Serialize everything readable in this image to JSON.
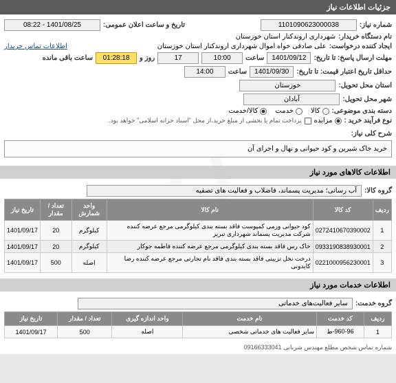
{
  "header": {
    "title": "جزئیات اطلاعات نیاز"
  },
  "info": {
    "need_number_label": "شماره نیاز:",
    "need_number": "1101090623000038",
    "announce_label": "تاریخ و ساعت اعلان عمومی:",
    "announce_value": "1401/08/25 - 08:22",
    "buyer_org_label": "نام دستگاه خریدار:",
    "buyer_org": "شهرداری اروندکنار استان خوزستان",
    "requester_label": "ایجاد کننده درخواست:",
    "requester": "علی صادقی خواه اموال شهرداری اروندکنار استان خوزستان",
    "contact_link": "اطلاعات تماس خریدار",
    "deadline_label": "مهلت ارسال پاسخ: تا تاریخ:",
    "deadline_date": "1401/09/12",
    "time_label": "ساعت",
    "deadline_time": "10:00",
    "days_remaining": "17",
    "days_label": "روز و",
    "countdown": "01:28:18",
    "countdown_label": "ساعت باقی مانده",
    "validity_label": "حداقل تاریخ اعتبار قیمت: تا تاریخ:",
    "validity_date": "1401/09/30",
    "validity_time": "14:00",
    "province_label": "استان محل تحویل:",
    "province": "خوزستان",
    "city_label": "شهر محل تحویل:",
    "city": "آبادان",
    "subject_type_label": "دسته بندی موضوعی:",
    "radio_goods": "کالا",
    "radio_service": "خدمت",
    "radio_both": "کالا/خدمت",
    "process_label": "نوع فرآیند خرید :",
    "radio_mazayede": "مزایده",
    "payment_note": "پرداخت تمام یا بخشی از مبلغ خرید،از محل \"اسناد خزانه اسلامی\" خواهد بود.",
    "desc_label": "شرح کلی نیاز:",
    "desc_text": "خرید خاک شیرین و کود حیوانی و نهال و اجرای آن"
  },
  "goods_section": {
    "title": "اطلاعات کالاهای مورد نیاز",
    "group_label": "گروه کالا:",
    "group_value": "آب رسانی؛ مدیریت پسماند، فاضلاب و فعالیت های تصفیه",
    "headers": [
      "ردیف",
      "کد کالا",
      "نام کالا",
      "واحد شمارش",
      "تعداد / مقدار",
      "تاریخ نیاز"
    ],
    "rows": [
      {
        "idx": "1",
        "code": "0272410670390002",
        "name": "کود حیوانی ورمی کمپوست فاقد بسته بندی کیلوگرمی مرجع عرضه کننده شرکت مدیریت پسماند شهرداری تبریز",
        "unit": "کیلوگرم",
        "qty": "20",
        "date": "1401/09/17"
      },
      {
        "idx": "2",
        "code": "0933190838930001",
        "name": "خاک رس فاقد بسته بندی کیلوگرمی مرجع عرضه کننده فاطمه جوکار",
        "unit": "کیلوگرم",
        "qty": "20",
        "date": "1401/09/17"
      },
      {
        "idx": "3",
        "code": "0221000956230001",
        "name": "درخت نخل تزیینی فاقد بسته بندی فاقد نام تجارتی مرجع عرضه کننده رضا کایدونی",
        "unit": "اصله",
        "qty": "500",
        "date": "1401/09/17"
      }
    ]
  },
  "services_section": {
    "title": "اطلاعات خدمات مورد نیاز",
    "group_label": "گروه خدمت:",
    "group_value": "سایر فعالیت‌های خدماتی",
    "headers": [
      "ردیف",
      "کد خدمت",
      "نام خدمت",
      "واحد اندازه گیری",
      "تعداد / مقدار",
      "تاریخ نیاز"
    ],
    "rows": [
      {
        "idx": "1",
        "code": "960-96-ط",
        "name": "سایر فعالیت های خدماتی شخصی",
        "unit": "اصله",
        "qty": "500",
        "date": "1401/09/17"
      }
    ]
  },
  "footer": {
    "contact": "شماره تماس شخص مطلع مهندس شربانی 09166333041"
  }
}
